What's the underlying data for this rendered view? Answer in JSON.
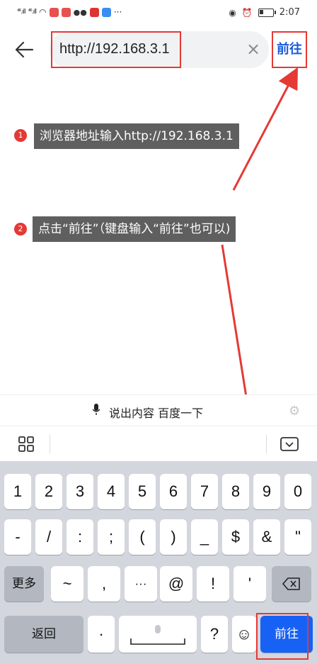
{
  "status_bar": {
    "signal_1": "⁴⁶.ıll",
    "signal_2": "⁴⁶.ıll",
    "time": "2:07",
    "icons": [
      "wifi-icon",
      "app-icon",
      "app-icon",
      "wechat-icon",
      "app-icon",
      "app-icon",
      "more-dots-icon",
      "eye-icon",
      "alarm-icon",
      "battery-icon"
    ]
  },
  "url_bar": {
    "url": "http://192.168.3.1",
    "go_label": "前往"
  },
  "annotations": [
    {
      "number": "1",
      "text": "浏览器地址输入http://192.168.3.1"
    },
    {
      "number": "2",
      "text": "点击“前往”（键盘输入“前往”也可以)"
    }
  ],
  "keyboard": {
    "voice_label": "说出内容 百度一下",
    "row1": [
      "1",
      "2",
      "3",
      "4",
      "5",
      "6",
      "7",
      "8",
      "9",
      "0"
    ],
    "row2": [
      "-",
      "/",
      ":",
      ";",
      "(",
      ")",
      "_",
      "$",
      "&",
      "\""
    ],
    "row3": [
      "更多",
      "~",
      ",",
      "···",
      "@",
      "!",
      "'"
    ],
    "row4": {
      "back": "返回",
      "dot": "·",
      "question": "?",
      "go": "前往"
    }
  },
  "colors": {
    "accent": "#1861f5",
    "highlight": "#e53935",
    "link": "#1a5cd8"
  }
}
